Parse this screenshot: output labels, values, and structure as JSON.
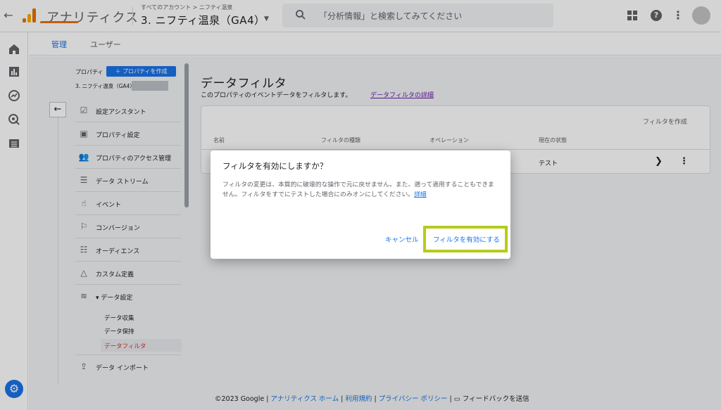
{
  "topbar": {
    "app_name": "アナリティクス",
    "breadcrumb": "すべてのアカウント > ニフティ温泉",
    "property_name": "3. ニフティ温泉（GA4）",
    "search_placeholder": "「分析情報」と検索してみてください"
  },
  "tabs": [
    {
      "label": "管理",
      "active": true
    },
    {
      "label": "ユーザー",
      "active": false
    }
  ],
  "left_panel": {
    "property_label": "プロパティ",
    "create_property": "＋ プロパティを作成",
    "selected_property": "3. ニフティ温泉（GA4）",
    "items": [
      {
        "label": "設定アシスタント",
        "icon": "checklist-icon"
      },
      {
        "label": "プロパティ設定",
        "icon": "layout-icon"
      },
      {
        "label": "プロパティのアクセス管理",
        "icon": "people-icon"
      },
      {
        "label": "データ ストリーム",
        "icon": "streams-icon"
      },
      {
        "label": "イベント",
        "icon": "touch-icon"
      },
      {
        "label": "コンバージョン",
        "icon": "flag-icon"
      },
      {
        "label": "オーディエンス",
        "icon": "audience-icon"
      },
      {
        "label": "カスタム定義",
        "icon": "shapes-icon"
      },
      {
        "label": "▾ データ設定",
        "icon": "database-icon"
      }
    ],
    "sub_items": [
      {
        "label": "データ収集",
        "active": false
      },
      {
        "label": "データ保持",
        "active": false
      },
      {
        "label": "データフィルタ",
        "active": true
      }
    ],
    "last_item": {
      "label": "データ インポート",
      "icon": "upload-icon"
    }
  },
  "main": {
    "title": "データフィルタ",
    "description": "このプロパティのイベントデータをフィルタします。",
    "description_link": "データフィルタの詳細",
    "create_filter": "フィルタを作成",
    "columns": [
      "名前",
      "フィルタの種類",
      "オペレーション",
      "現在の状態"
    ],
    "row": {
      "status": "テスト"
    }
  },
  "footer": {
    "copyright": "©2023 Google",
    "links": [
      "アナリティクス ホーム",
      "利用規約",
      "プライバシー ポリシー"
    ],
    "feedback": "フィードバックを送信"
  },
  "dialog": {
    "title": "フィルタを有効にしますか？",
    "body": "フィルタの変更は、本質的に破壊的な操作で元に戻せません。また、遡って適用することもできません。フィルタをすでにテストした場合にのみオンにしてください。",
    "body_link": "詳細",
    "cancel": "キャンセル",
    "confirm": "フィルタを有効にする"
  },
  "colors": {
    "accent": "#1a73e8",
    "highlight": "#b5cc18",
    "tab_underline": "#e37400",
    "active_sub": "#d93025"
  }
}
